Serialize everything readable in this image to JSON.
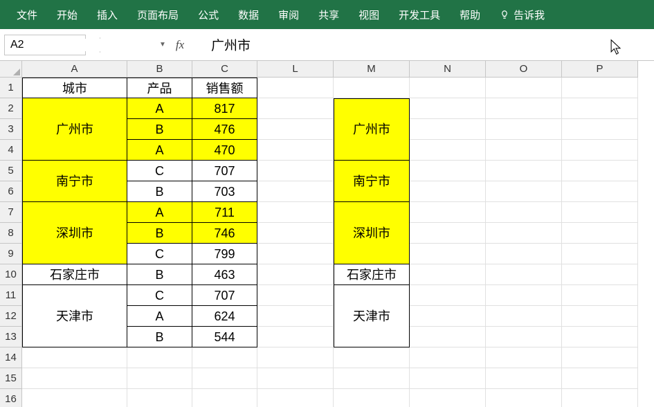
{
  "ribbon": {
    "tabs": [
      "文件",
      "开始",
      "插入",
      "页面布局",
      "公式",
      "数据",
      "审阅",
      "共享",
      "视图",
      "开发工具",
      "帮助"
    ],
    "tell_me": "告诉我"
  },
  "formula_bar": {
    "name_box": "A2",
    "fx_label": "fx",
    "value": "广州市"
  },
  "columns": {
    "labels": [
      "A",
      "B",
      "C",
      "L",
      "M",
      "N",
      "O",
      "P"
    ],
    "widths": [
      152,
      94,
      94,
      110,
      110,
      110,
      110,
      110
    ]
  },
  "row_count": 16,
  "table_left": {
    "header": {
      "city": "城市",
      "product": "产品",
      "sales": "销售额"
    },
    "groups": [
      {
        "city": "广州市",
        "highlight": true,
        "rows": [
          {
            "p": "A",
            "s": 817,
            "hl": true
          },
          {
            "p": "B",
            "s": 476,
            "hl": true
          },
          {
            "p": "A",
            "s": 470,
            "hl": true
          }
        ]
      },
      {
        "city": "南宁市",
        "highlight": true,
        "rows": [
          {
            "p": "C",
            "s": 707,
            "hl": false
          },
          {
            "p": "B",
            "s": 703,
            "hl": false
          }
        ]
      },
      {
        "city": "深圳市",
        "highlight": true,
        "rows": [
          {
            "p": "A",
            "s": 711,
            "hl": true
          },
          {
            "p": "B",
            "s": 746,
            "hl": true
          },
          {
            "p": "C",
            "s": 799,
            "hl": false
          }
        ]
      },
      {
        "city": "石家庄市",
        "highlight": false,
        "rows": [
          {
            "p": "B",
            "s": 463,
            "hl": false
          }
        ]
      },
      {
        "city": "天津市",
        "highlight": false,
        "rows": [
          {
            "p": "C",
            "s": 707,
            "hl": false
          },
          {
            "p": "A",
            "s": 624,
            "hl": false
          },
          {
            "p": "B",
            "s": 544,
            "hl": false
          }
        ]
      }
    ]
  },
  "table_right": {
    "groups": [
      {
        "city": "广州市",
        "span": 3,
        "highlight": true
      },
      {
        "city": "南宁市",
        "span": 2,
        "highlight": true
      },
      {
        "city": "深圳市",
        "span": 3,
        "highlight": true
      },
      {
        "city": "石家庄市",
        "span": 1,
        "highlight": false
      },
      {
        "city": "天津市",
        "span": 3,
        "highlight": false
      }
    ]
  }
}
